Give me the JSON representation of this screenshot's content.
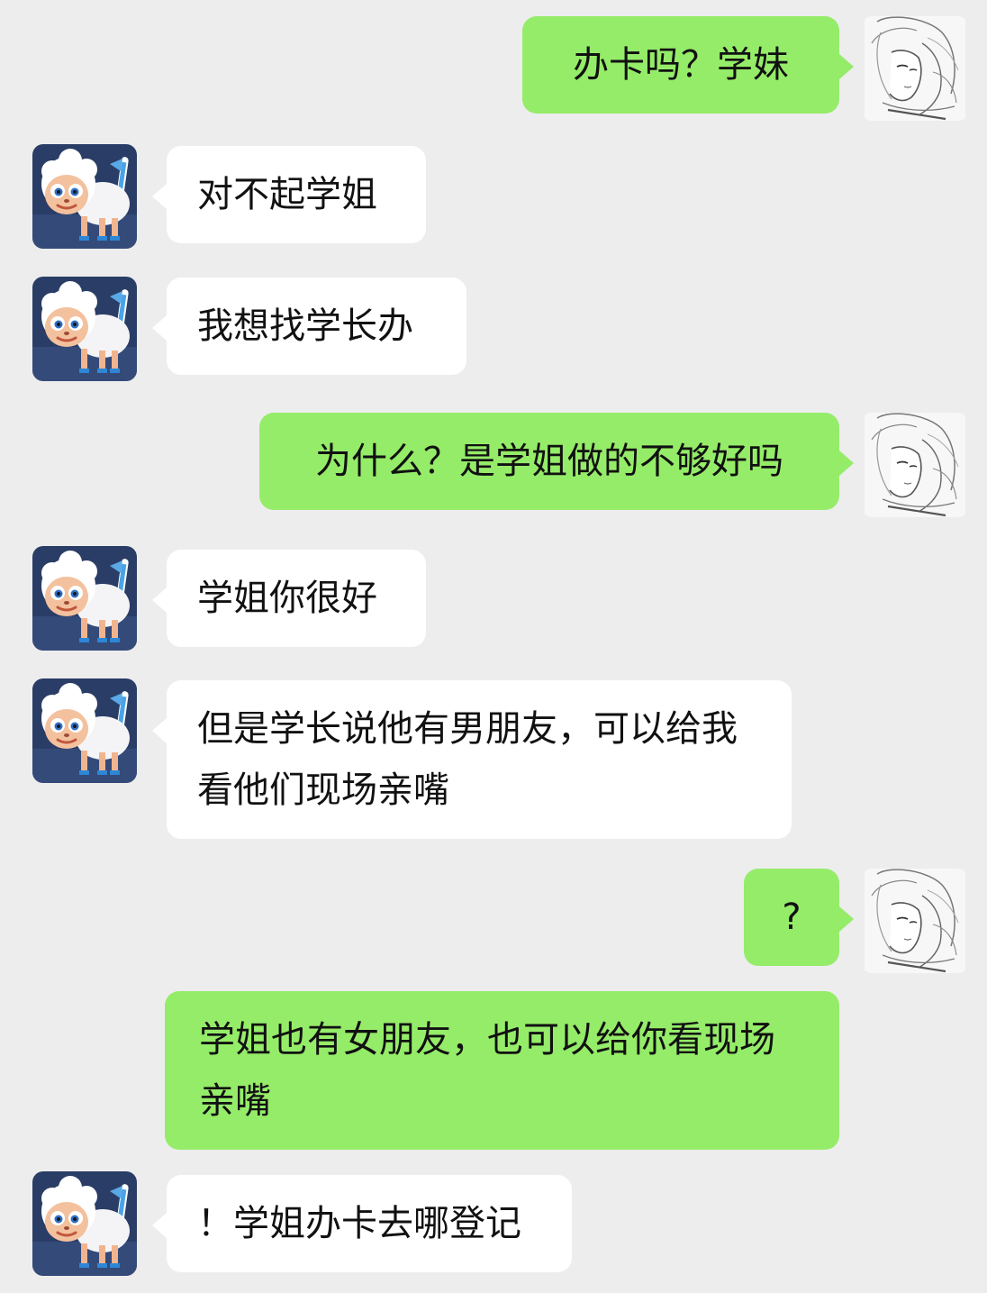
{
  "colors": {
    "background": "#ededed",
    "outgoing_bubble": "#95ec69",
    "incoming_bubble": "#ffffff",
    "text": "#111111"
  },
  "contacts": {
    "self_avatar": "sketch-girl-avatar-icon",
    "other_avatar": "white-sheep-avatar-icon"
  },
  "messages": [
    {
      "sender": "self",
      "text": "办卡吗？学妹"
    },
    {
      "sender": "other",
      "text": "对不起学姐"
    },
    {
      "sender": "other",
      "text": "我想找学长办"
    },
    {
      "sender": "self",
      "text": "为什么？是学姐做的不够好吗"
    },
    {
      "sender": "other",
      "text": "学姐你很好"
    },
    {
      "sender": "other",
      "text": "但是学长说他有男朋友，可以给我看他们现场亲嘴"
    },
    {
      "sender": "self",
      "text": "?"
    },
    {
      "sender": "self",
      "text": "学姐也有女朋友，也可以给你看现场亲嘴"
    },
    {
      "sender": "other",
      "text": "！学姐办卡去哪登记"
    }
  ]
}
